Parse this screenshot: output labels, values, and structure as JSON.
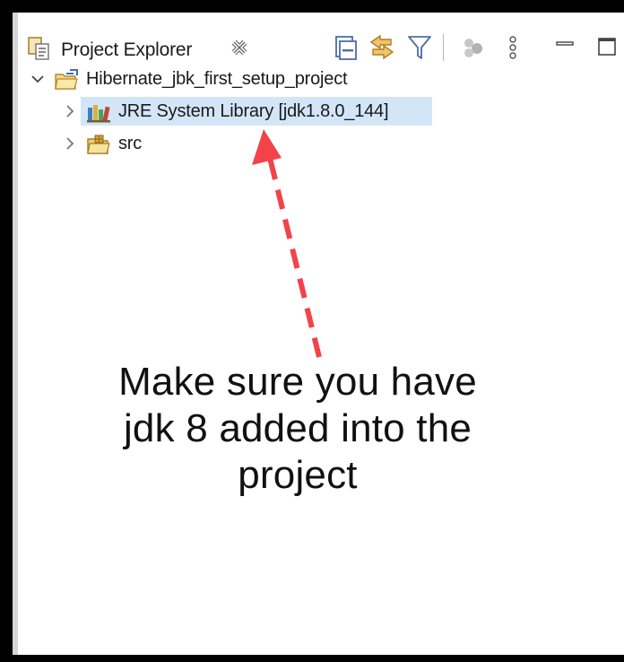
{
  "view": {
    "title": "Project Explorer",
    "toolbar": [
      {
        "name": "collapse-all-icon"
      },
      {
        "name": "link-with-editor-icon"
      },
      {
        "name": "filter-icon"
      },
      {
        "name": "working-sets-icon"
      },
      {
        "name": "view-menu-icon"
      },
      {
        "name": "minimize-icon"
      },
      {
        "name": "maximize-icon"
      }
    ]
  },
  "tree": {
    "project": {
      "label": "Hibernate_jbk_first_setup_project",
      "expanded": true
    },
    "children": [
      {
        "label": "JRE System Library [jdk1.8.0_144]",
        "selected": true,
        "icon": "library-icon"
      },
      {
        "label": "src",
        "selected": false,
        "icon": "package-folder-icon"
      }
    ]
  },
  "annotation": {
    "lines": [
      "Make sure you have",
      "jdk 8 added into the",
      "project"
    ],
    "arrow_color": "#f2434b"
  },
  "colors": {
    "selection": "#d3e6f8",
    "border": "#000000"
  }
}
